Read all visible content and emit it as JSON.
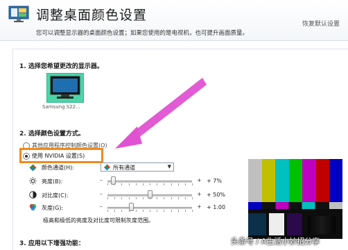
{
  "header": {
    "title": "调整桌面颜色设置",
    "subtitle": "您可以调整显示器的桌面颜色设置；如果您使用的是电视机，也可提升画面质量。",
    "restore_link": "恢复默认设置"
  },
  "section1": {
    "title": "1.  选择您希望更改的显示器。",
    "monitor_label": "Samsung S22..."
  },
  "section2": {
    "title": "2.  选择颜色设置方式。",
    "option_app": "其他应用程序控制颜色设置(O)",
    "option_nvidia": "使用 NVIDIA 设置(S)",
    "channel_label": "颜色通道(H):",
    "channel_value": "所有通道",
    "brightness_label": "亮度(B):",
    "brightness_value": "+ 7%",
    "brightness_level": 0.07,
    "contrast_label": "对比度(C):",
    "contrast_value": "+ 50%",
    "contrast_level": 0.5,
    "gamma_label": "灰度(G):",
    "gamma_value": "+ 1.00",
    "gamma_level": 0.28,
    "note": "极高和极低的亮度及对比度可限制灰度范围。",
    "dash": "–",
    "plus": "+"
  },
  "section3": {
    "title": "3.  应用以下增强功能："
  },
  "watermark": "头条号 / A生活小妙招分享",
  "colors": {
    "highlight": "#f08a1e",
    "arrow": "#e052d2",
    "monitor": "#4cd4a8"
  }
}
